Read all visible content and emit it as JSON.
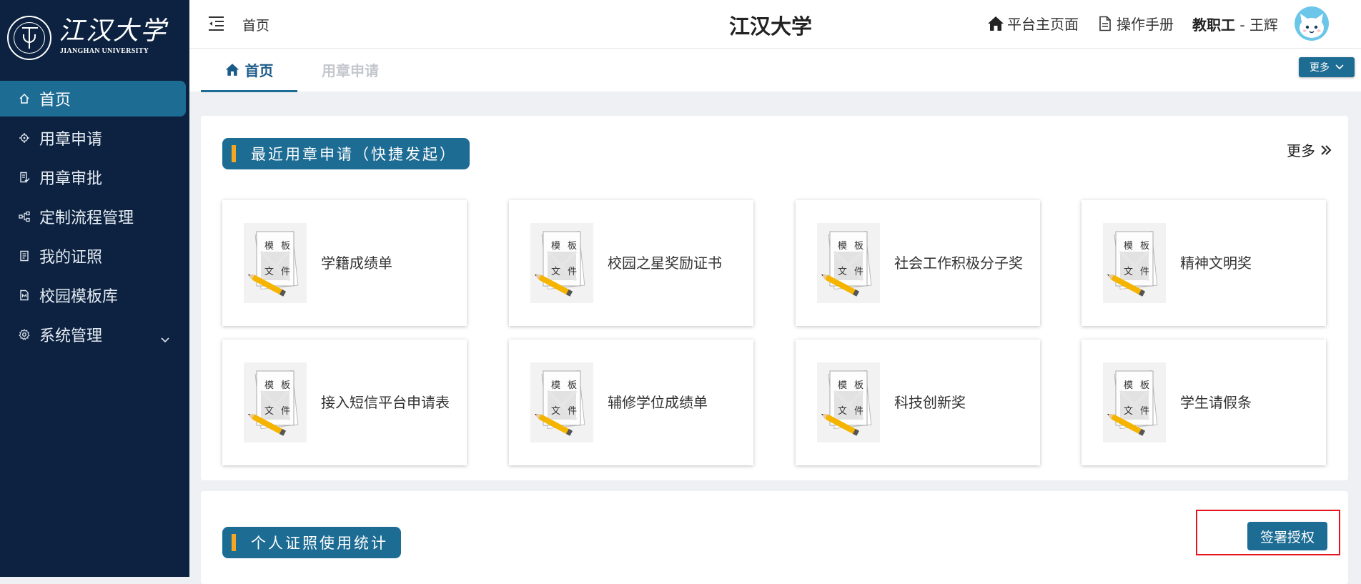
{
  "logo": {
    "cn": "江汉大学",
    "en": "JIANGHAN UNIVERSITY"
  },
  "sidebar": {
    "items": [
      {
        "label": "首页",
        "icon": "home-icon",
        "active": true
      },
      {
        "label": "用章申请",
        "icon": "target-icon"
      },
      {
        "label": "用章审批",
        "icon": "doc-check-icon"
      },
      {
        "label": "定制流程管理",
        "icon": "flow-icon"
      },
      {
        "label": "我的证照",
        "icon": "certificate-icon"
      },
      {
        "label": "校园模板库",
        "icon": "template-icon"
      },
      {
        "label": "系统管理",
        "icon": "gear-icon",
        "expandable": true
      }
    ]
  },
  "header": {
    "breadcrumb": "首页",
    "title": "江汉大学",
    "platform_link": "平台主页面",
    "manual_link": "操作手册",
    "user_role": "教职工",
    "user_sep": " - ",
    "user_name": "王辉"
  },
  "tabs": [
    {
      "label": "首页",
      "active": true
    },
    {
      "label": "用章申请",
      "active": false
    }
  ],
  "more_button": "更多",
  "recent": {
    "title": "最近用章申请（快捷发起）",
    "more_label": "更多",
    "cards": [
      {
        "label": "学籍成绩单"
      },
      {
        "label": "校园之星奖励证书"
      },
      {
        "label": "社会工作积极分子奖"
      },
      {
        "label": "精神文明奖"
      },
      {
        "label": "接入短信平台申请表"
      },
      {
        "label": "辅修学位成绩单"
      },
      {
        "label": "科技创新奖"
      },
      {
        "label": "学生请假条"
      }
    ],
    "thumb_chars": [
      "模",
      "板",
      "文",
      "件"
    ]
  },
  "stats": {
    "title": "个人证照使用统计",
    "sign_button": "签署授权"
  },
  "colors": {
    "sidebar_bg": "#0c2240",
    "accent": "#1d6c94",
    "title_bar_stripe": "#f5a623",
    "highlight": "#e8141b"
  }
}
